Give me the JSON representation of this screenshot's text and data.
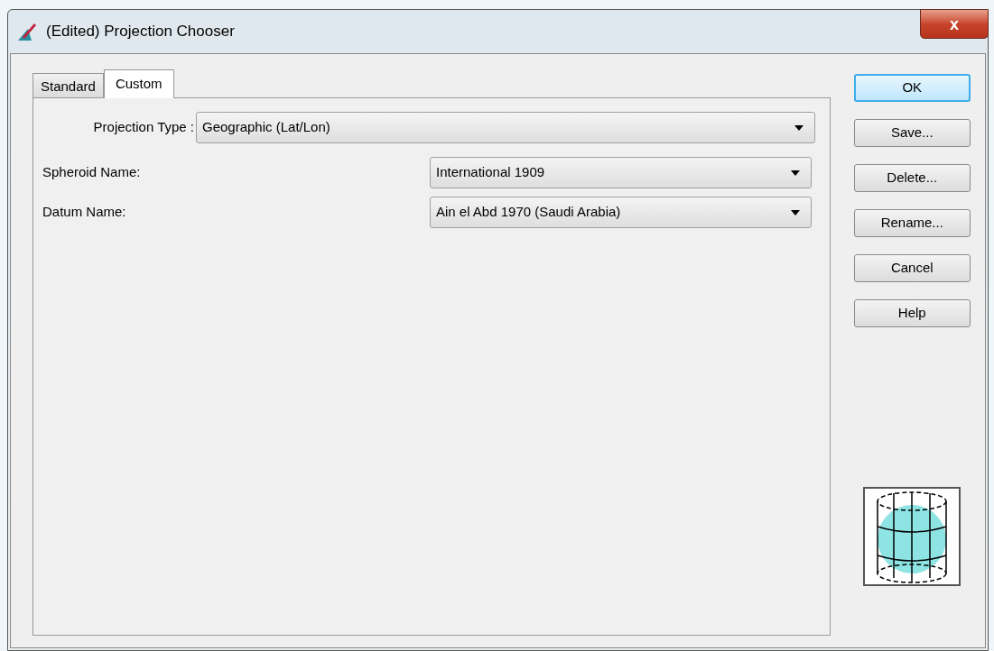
{
  "window": {
    "title": "(Edited) Projection Chooser",
    "close_label": "x"
  },
  "tabs": [
    {
      "label": "Standard",
      "selected": false
    },
    {
      "label": "Custom",
      "selected": true
    }
  ],
  "projection_type": {
    "label": "Projection Type :",
    "value": "Geographic (Lat/Lon)"
  },
  "fields": [
    {
      "label": "Spheroid Name:",
      "value": "International 1909"
    },
    {
      "label": "Datum Name:",
      "value": "Ain el Abd 1970 (Saudi Arabia)"
    }
  ],
  "buttons": [
    {
      "label": "OK",
      "default": true
    },
    {
      "label": "Save...",
      "default": false
    },
    {
      "label": "Delete...",
      "default": false
    },
    {
      "label": "Rename...",
      "default": false
    },
    {
      "label": "Cancel",
      "default": false
    },
    {
      "label": "Help",
      "default": false
    }
  ]
}
